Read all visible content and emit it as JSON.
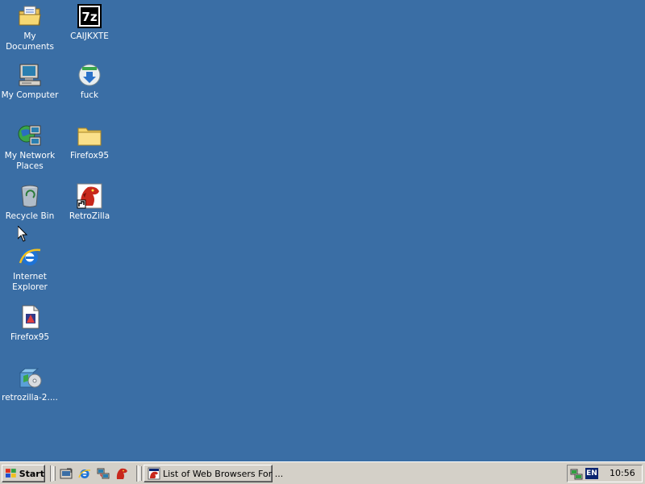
{
  "desktop": {
    "background": "#3a6ea5",
    "icons": [
      {
        "label": "My Documents",
        "icon": "my-documents-icon"
      },
      {
        "label": "My Computer",
        "icon": "my-computer-icon"
      },
      {
        "label": "My Network Places",
        "icon": "network-places-icon"
      },
      {
        "label": "Recycle Bin",
        "icon": "recycle-bin-icon"
      },
      {
        "label": "Internet Explorer",
        "icon": "internet-explorer-icon"
      },
      {
        "label": "Firefox95",
        "icon": "installer-file-icon"
      },
      {
        "label": "retrozilla-2....",
        "icon": "setup-package-icon"
      },
      {
        "label": "CAIJKXTE",
        "icon": "7zip-icon"
      },
      {
        "label": "fuck",
        "icon": "download-installer-icon"
      },
      {
        "label": "Firefox95",
        "icon": "folder-icon"
      },
      {
        "label": "RetroZilla",
        "icon": "retrozilla-shortcut-icon"
      }
    ]
  },
  "taskbar": {
    "start_label": "Start",
    "quick_launch": [
      "show-desktop-icon",
      "internet-explorer-icon",
      "network-icon",
      "retrozilla-icon"
    ],
    "task_label": "List of Web Browsers For ...",
    "tray": {
      "language": "EN",
      "clock": "10:56"
    }
  }
}
